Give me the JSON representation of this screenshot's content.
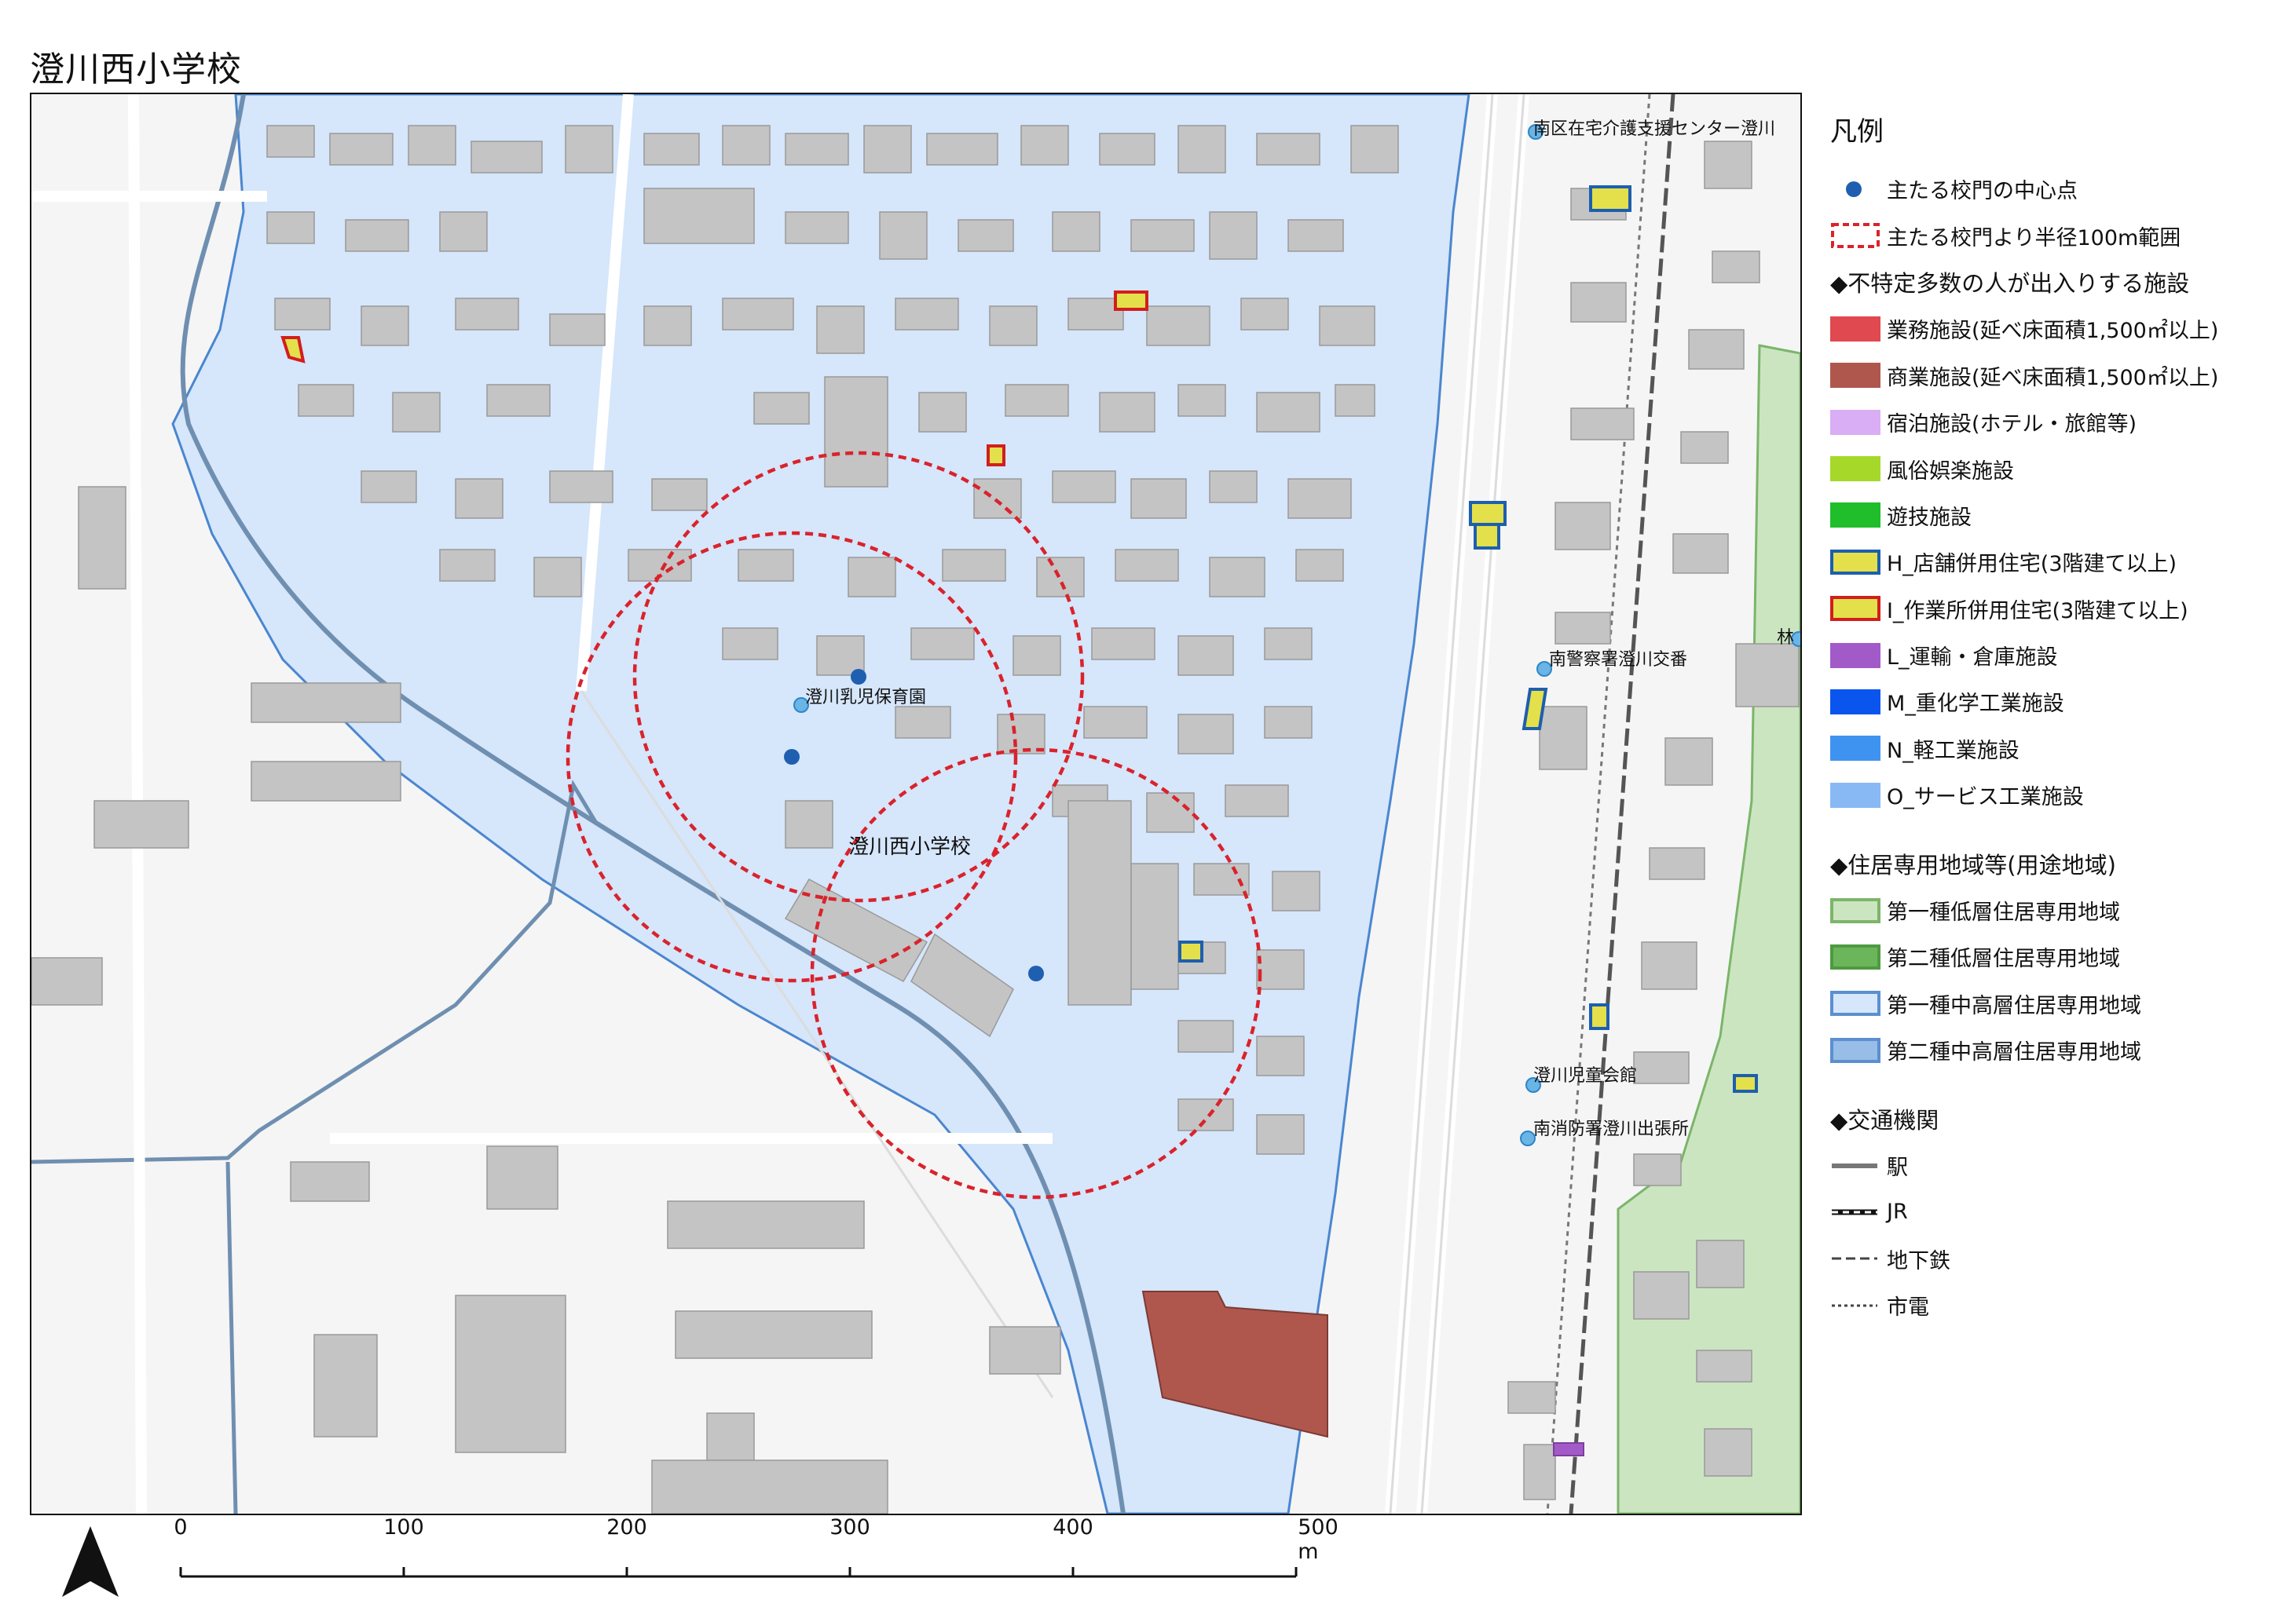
{
  "title": "澄川西小学校",
  "map": {
    "labels": {
      "school": "澄川西小学校",
      "nursery": "澄川乳児保育園",
      "care_center": "南区在宅介護支援センター澄川",
      "police": "南警察署澄川交番",
      "childrens_hall": "澄川児童会館",
      "fire": "南消防署澄川出張所",
      "edge": "林"
    },
    "colors": {
      "zone_mid_high_1": "#d6e6fb",
      "zone_low_1": "#cce5c1",
      "commercial": "#b0574d",
      "building": "#c4c4c4",
      "circle": "#d9232c",
      "gate": "#1f5fb0",
      "facility_point": "#6ab4e6",
      "shop_house_fill": "#e3e04b",
      "shop_house_border": "#1d5fae",
      "work_house_border": "#d21e1e"
    }
  },
  "legend": {
    "title": "凡例",
    "gate_point": "主たる校門の中心点",
    "radius_range": "主たる校門より半径100m範囲",
    "section_facilities": "◆不特定多数の人が出入りする施設",
    "facilities": [
      {
        "label": "業務施設(延べ床面積1,500㎡以上)",
        "color": "#e0494f",
        "border": "#e0494f"
      },
      {
        "label": "商業施設(延べ床面積1,500㎡以上)",
        "color": "#b0574d",
        "border": "#b0574d"
      },
      {
        "label": "宿泊施設(ホテル・旅館等)",
        "color": "#d9aef5",
        "border": "#d9aef5"
      },
      {
        "label": "風俗娯楽施設",
        "color": "#a6d82a",
        "border": "#a6d82a"
      },
      {
        "label": "遊技施設",
        "color": "#1fbe2a",
        "border": "#1fbe2a"
      },
      {
        "label": "H_店舗併用住宅(3階建て以上)",
        "color": "#e3e04b",
        "border": "#1d5fae"
      },
      {
        "label": "I_作業所併用住宅(3階建て以上)",
        "color": "#e3e04b",
        "border": "#d21e1e"
      },
      {
        "label": "L_運輸・倉庫施設",
        "color": "#a35ac9",
        "border": "#a35ac9"
      },
      {
        "label": "M_重化学工業施設",
        "color": "#0b55ef",
        "border": "#0b55ef"
      },
      {
        "label": "N_軽工業施設",
        "color": "#3f93f0",
        "border": "#3f93f0"
      },
      {
        "label": "O_サービス工業施設",
        "color": "#88b9f5",
        "border": "#88b9f5"
      }
    ],
    "section_zones": "◆住居専用地域等(用途地域)",
    "zones": [
      {
        "label": "第一種低層住居専用地域",
        "color": "#cce5c1",
        "border": "#7bb56a"
      },
      {
        "label": "第二種低層住居専用地域",
        "color": "#6bb55a",
        "border": "#4f9a40"
      },
      {
        "label": "第一種中高層住居専用地域",
        "color": "#d6e6fb",
        "border": "#5b8fd0"
      },
      {
        "label": "第二種中高層住居専用地域",
        "color": "#98bde6",
        "border": "#5b8fd0"
      }
    ],
    "section_transport": "◆交通機関",
    "transport": [
      {
        "label": "駅",
        "style": "station"
      },
      {
        "label": "JR",
        "style": "jr"
      },
      {
        "label": "地下鉄",
        "style": "subway"
      },
      {
        "label": "市電",
        "style": "tram"
      }
    ]
  },
  "scale": {
    "ticks": [
      "0",
      "100",
      "200",
      "300",
      "400",
      "500 m"
    ],
    "max_m": 500
  }
}
